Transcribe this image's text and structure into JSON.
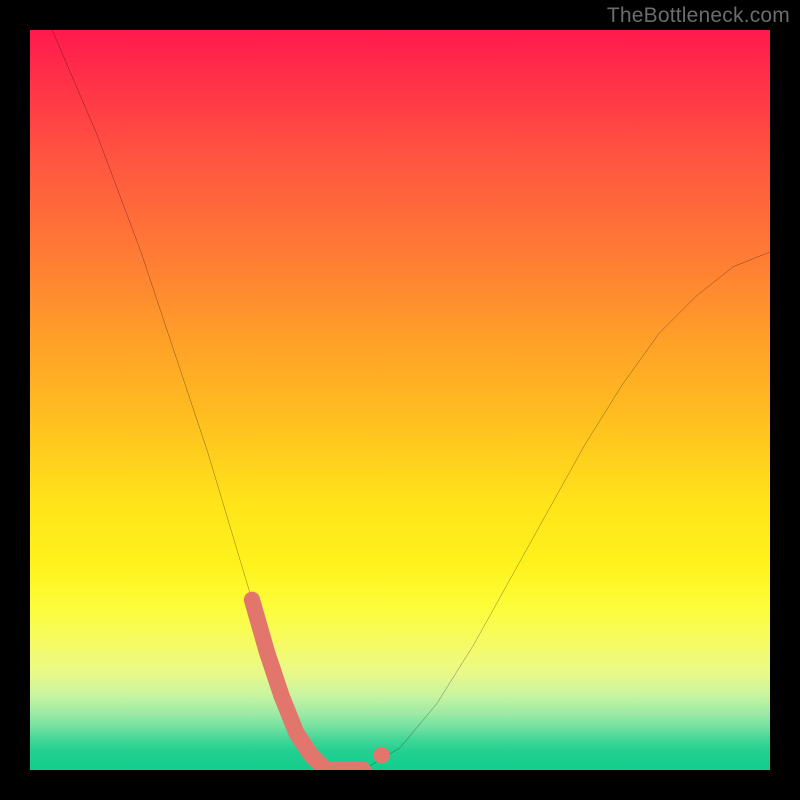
{
  "watermark": "TheBottleneck.com",
  "chart_data": {
    "type": "line",
    "title": "",
    "xlabel": "",
    "ylabel": "",
    "xlim": [
      0,
      100
    ],
    "ylim": [
      0,
      100
    ],
    "background_gradient": {
      "top_color_meaning": "bad",
      "bottom_color_meaning": "good",
      "stops": [
        {
          "pos": 0,
          "color": "#ff1a4d"
        },
        {
          "pos": 50,
          "color": "#ffc31f"
        },
        {
          "pos": 78,
          "color": "#fdfd3a"
        },
        {
          "pos": 100,
          "color": "#12ce8d"
        }
      ]
    },
    "series": [
      {
        "name": "bottleneck-curve",
        "stroke": "#000000",
        "x": [
          0,
          3,
          6,
          9,
          12,
          15,
          18,
          21,
          24,
          27,
          30,
          32,
          34,
          36,
          38,
          40,
          45,
          50,
          55,
          60,
          65,
          70,
          75,
          80,
          85,
          90,
          95,
          100
        ],
        "y": [
          106,
          100,
          93,
          86,
          78,
          70,
          61,
          52,
          43,
          33,
          23,
          16,
          10,
          5,
          2,
          0,
          0,
          3,
          9,
          17,
          26,
          35,
          44,
          52,
          59,
          64,
          68,
          70
        ]
      },
      {
        "name": "highlight-bottom",
        "stroke": "#e2766d",
        "stroke_width": 14,
        "linecap": "round",
        "x": [
          30,
          32,
          34,
          36,
          38,
          40,
          43,
          45
        ],
        "y": [
          23,
          16,
          10,
          5,
          2,
          0,
          0,
          0
        ]
      },
      {
        "name": "highlight-dot-right",
        "stroke": "#e2766d",
        "type_hint": "point",
        "x": [
          47.5
        ],
        "y": [
          2
        ]
      }
    ],
    "notes": "Axes are unlabeled in the source image; values are approximate readings on a 0–100 normalized scale. The curve represents a bottleneck/mismatch metric (higher = worse, touching bottom = optimal). The pink segment highlights the near-optimal range."
  }
}
